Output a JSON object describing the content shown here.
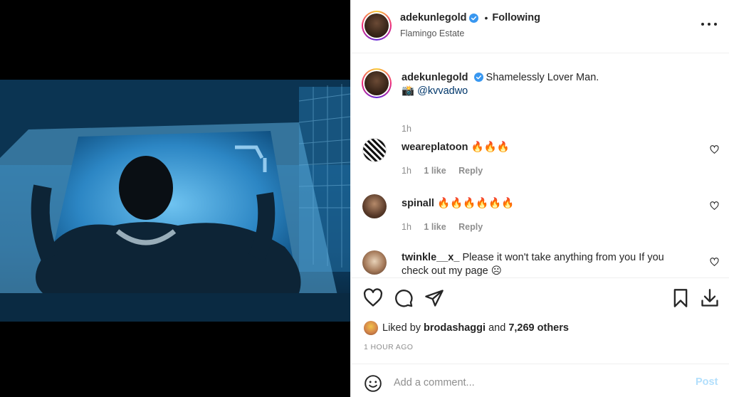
{
  "post": {
    "username": "adekunlegold",
    "follow_separator": "•",
    "follow_label": "Following",
    "location": "Flamingo Estate",
    "caption_user": "adekunlegold",
    "caption_text": "Shamelessly Lover Man.",
    "caption_credit_emoji": "📸",
    "caption_mention": "@kvvadwo",
    "caption_time": "1h"
  },
  "comments": [
    {
      "user": "weareplatoon",
      "text": "🔥🔥🔥",
      "time": "1h",
      "likes": "1 like",
      "reply": "Reply"
    },
    {
      "user": "spinall",
      "text": "🔥🔥🔥🔥🔥🔥",
      "time": "1h",
      "likes": "1 like",
      "reply": "Reply"
    },
    {
      "user": "twinkle__x_",
      "text": "Please it won't take anything from you If you check out my page ☹"
    }
  ],
  "likes": {
    "prefix": "Liked by",
    "liker": "brodashaggi",
    "middle": "and",
    "others": "7,269 others"
  },
  "timestamp": "1 HOUR AGO",
  "composer": {
    "placeholder": "Add a comment...",
    "post_label": "Post"
  },
  "icons": {
    "verified": "verified-badge-icon",
    "more": "more-options-icon",
    "like": "heart-icon",
    "comment": "comment-icon",
    "share": "paper-plane-icon",
    "save": "bookmark-icon",
    "download": "download-icon",
    "emoji": "emoji-icon"
  },
  "colors": {
    "verified": "#3897f0",
    "link": "#00376b",
    "muted": "#8e8e8e",
    "post_disabled": "#b2dffc"
  }
}
